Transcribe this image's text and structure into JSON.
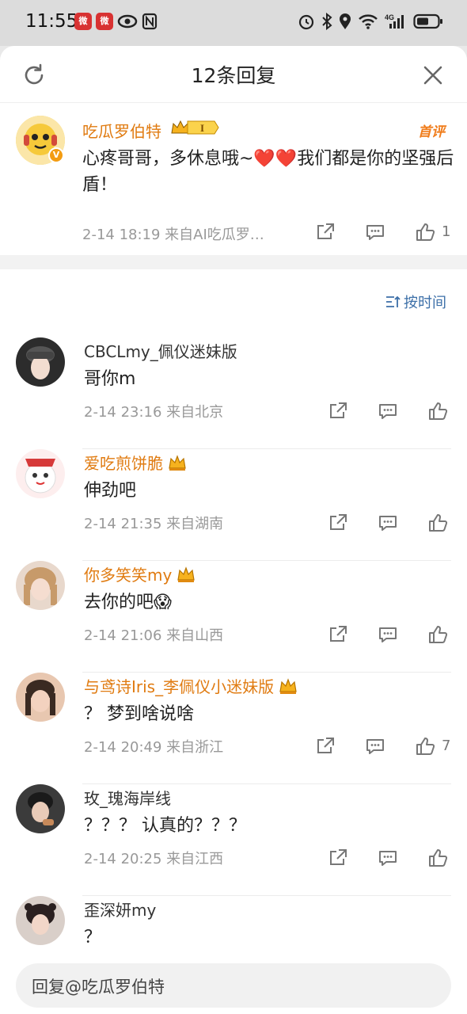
{
  "status_bar": {
    "time": "11:55",
    "app_badge_1": "微",
    "app_badge_2": "微",
    "icons": [
      "alarm-icon",
      "bluetooth-icon",
      "location-icon",
      "wifi-icon",
      "signal-4g-icon",
      "battery-icon"
    ]
  },
  "header": {
    "title": "12条回复"
  },
  "main_comment": {
    "username": "吃瓜罗伯特",
    "vip_level": "I",
    "tag": "首评",
    "text": "心疼哥哥，多休息哦~❤️❤️我们都是你的坚强后盾！",
    "meta": "2-14 18:19  来自AI吃瓜罗…",
    "like_count": "1"
  },
  "sort": {
    "label": "按时间"
  },
  "replies": [
    {
      "username": "CBCLmy_佩仪迷妹版",
      "gold": false,
      "crown": false,
      "text": "哥你m",
      "meta": "2-14 23:16  来自北京",
      "like_count": ""
    },
    {
      "username": "爱吃煎饼脆",
      "gold": true,
      "crown": true,
      "text": "伸劲吧",
      "meta": "2-14 21:35  来自湖南",
      "like_count": ""
    },
    {
      "username": "你多笑笑my",
      "gold": true,
      "crown": true,
      "text": "去你的吧😱",
      "meta": "2-14 21:06  来自山西",
      "like_count": ""
    },
    {
      "username": "与鸢诗Iris_李佩仪小迷妹版",
      "gold": true,
      "crown": true,
      "text": "？ 梦到啥说啥",
      "meta": "2-14 20:49  来自浙江",
      "like_count": "7"
    },
    {
      "username": "玫_瑰海岸线",
      "gold": false,
      "crown": false,
      "text": "？？？ 认真的？？？",
      "meta": "2-14 20:25  来自江西",
      "like_count": ""
    },
    {
      "username": "歪深妍my",
      "gold": false,
      "crown": false,
      "text": "？",
      "meta": "",
      "like_count": ""
    }
  ],
  "reply_bar": {
    "placeholder": "回复@吃瓜罗伯特"
  },
  "colors": {
    "gold_name": "#e07b11",
    "link_blue": "#3c6fa8",
    "meta_gray": "#999999"
  }
}
